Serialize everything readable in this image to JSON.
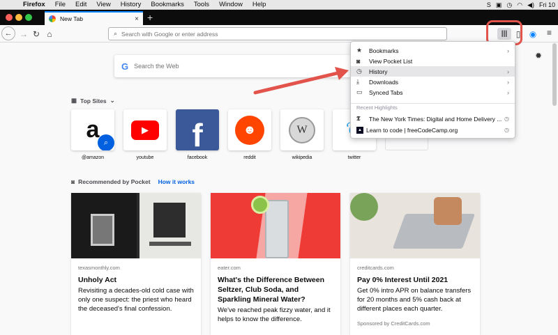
{
  "menubar": {
    "app": "Firefox",
    "items": [
      "File",
      "Edit",
      "View",
      "History",
      "Bookmarks",
      "Tools",
      "Window",
      "Help"
    ],
    "clock": "Fri 10"
  },
  "tab": {
    "title": "New Tab",
    "close": "×",
    "new_tab": "+"
  },
  "navbar": {
    "url_placeholder": "Search with Google or enter address"
  },
  "search": {
    "placeholder": "Search the Web",
    "logo": "G"
  },
  "top_sites": {
    "heading": "Top Sites",
    "sites": [
      {
        "label": "@amazon"
      },
      {
        "label": "youtube"
      },
      {
        "label": "facebook"
      },
      {
        "label": "reddit"
      },
      {
        "label": "wikipedia"
      },
      {
        "label": "twitter"
      }
    ]
  },
  "pocket": {
    "heading": "Recommended by Pocket",
    "how_link": "How it works",
    "cards": [
      {
        "source": "texasmonthly.com",
        "title": "Unholy Act",
        "description": "Revisiting a decades-old cold case with only one suspect: the priest who heard the deceased's final confession.",
        "sponsor": ""
      },
      {
        "source": "eater.com",
        "title": "What's the Difference Between Seltzer, Club Soda, and Sparkling Mineral Water?",
        "description": "We've reached peak fizzy water, and it helps to know the difference.",
        "sponsor": ""
      },
      {
        "source": "creditcards.com",
        "title": "Pay 0% Interest Until 2021",
        "description": "Get 0% intro APR on balance transfers for 20 months and 5% cash back at different places each quarter.",
        "sponsor": "Sponsored by CreditCards.com"
      }
    ]
  },
  "library_panel": {
    "items": [
      {
        "label": "Bookmarks",
        "arrow": "›"
      },
      {
        "label": "View Pocket List",
        "arrow": ""
      },
      {
        "label": "History",
        "arrow": "›"
      },
      {
        "label": "Downloads",
        "arrow": "›"
      },
      {
        "label": "Synced Tabs",
        "arrow": "›"
      }
    ],
    "recent_heading": "Recent Highlights",
    "recent": [
      {
        "label": "The New York Times: Digital and Home Delivery ..."
      },
      {
        "label": "Learn to code | freeCodeCamp.org"
      }
    ]
  },
  "colors": {
    "accent": "#0a84ff",
    "annotation": "#e2544b",
    "link": "#0060df"
  }
}
